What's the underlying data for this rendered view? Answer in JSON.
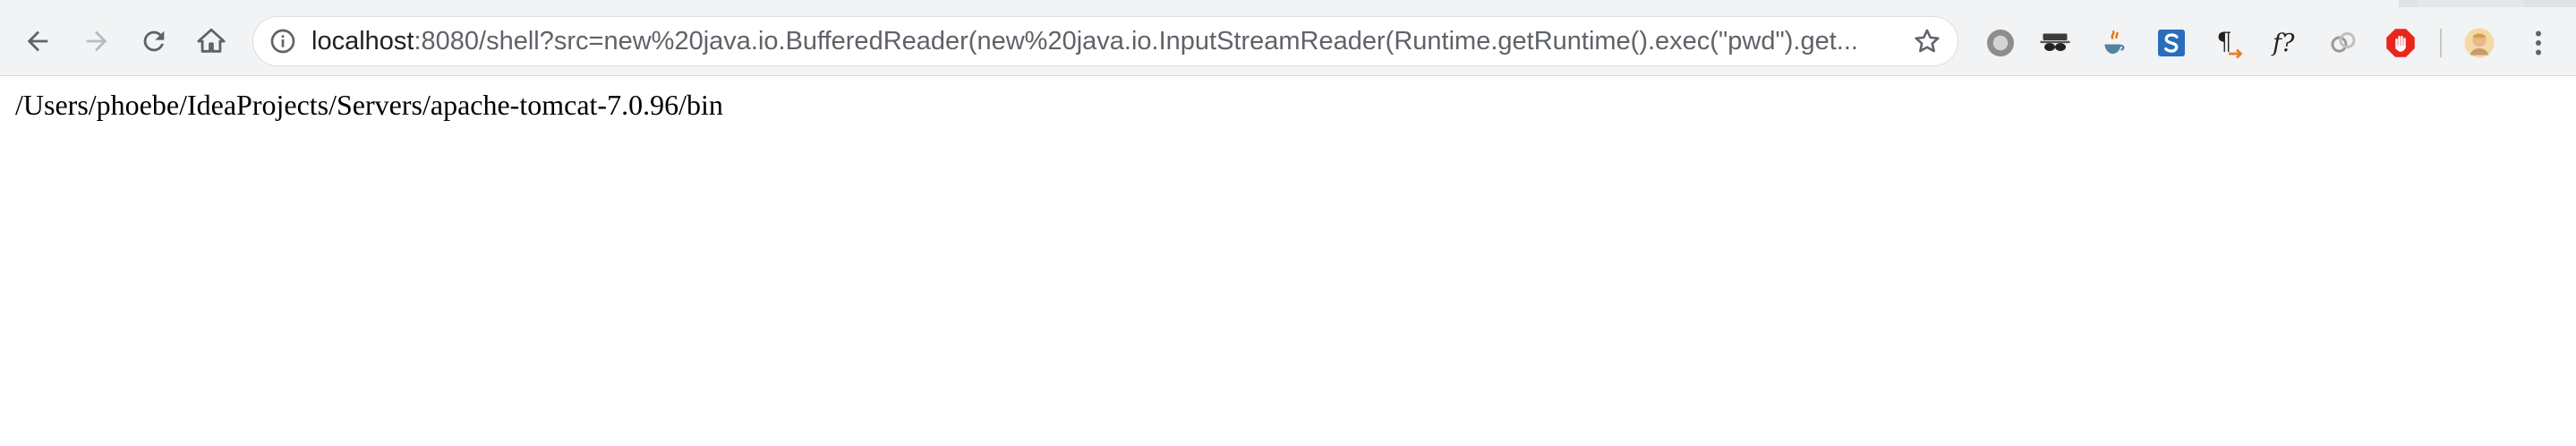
{
  "browser": {
    "url_host": "localhost",
    "url_rest": ":8080/shell?src=new%20java.io.BufferedReader(new%20java.io.InputStreamReader(Runtime.getRuntime().exec(\"pwd\").get..."
  },
  "extensions": [
    {
      "icon": "gray-circle-icon"
    },
    {
      "icon": "incognito-mask-icon"
    },
    {
      "icon": "java-cup-icon"
    },
    {
      "icon": "s-badge-icon"
    },
    {
      "icon": "pilcrow-arrow-icon"
    },
    {
      "icon": "function-icon"
    },
    {
      "icon": "chain-links-icon"
    },
    {
      "icon": "stop-hand-icon"
    },
    {
      "icon": "profile-avatar-icon"
    },
    {
      "icon": "kebab-menu-icon"
    }
  ],
  "labels": {
    "function_glyph": "f?",
    "pilcrow_glyph": "¶"
  },
  "page": {
    "output": "/Users/phoebe/IdeaProjects/Servers/apache-tomcat-7.0.96/bin"
  },
  "colors": {
    "toolbar_bg": "#f1f3f4",
    "url_host": "#202124",
    "url_rest": "#5f6368",
    "stop_red": "#e8261c",
    "s_blue": "#2a6ebb"
  }
}
